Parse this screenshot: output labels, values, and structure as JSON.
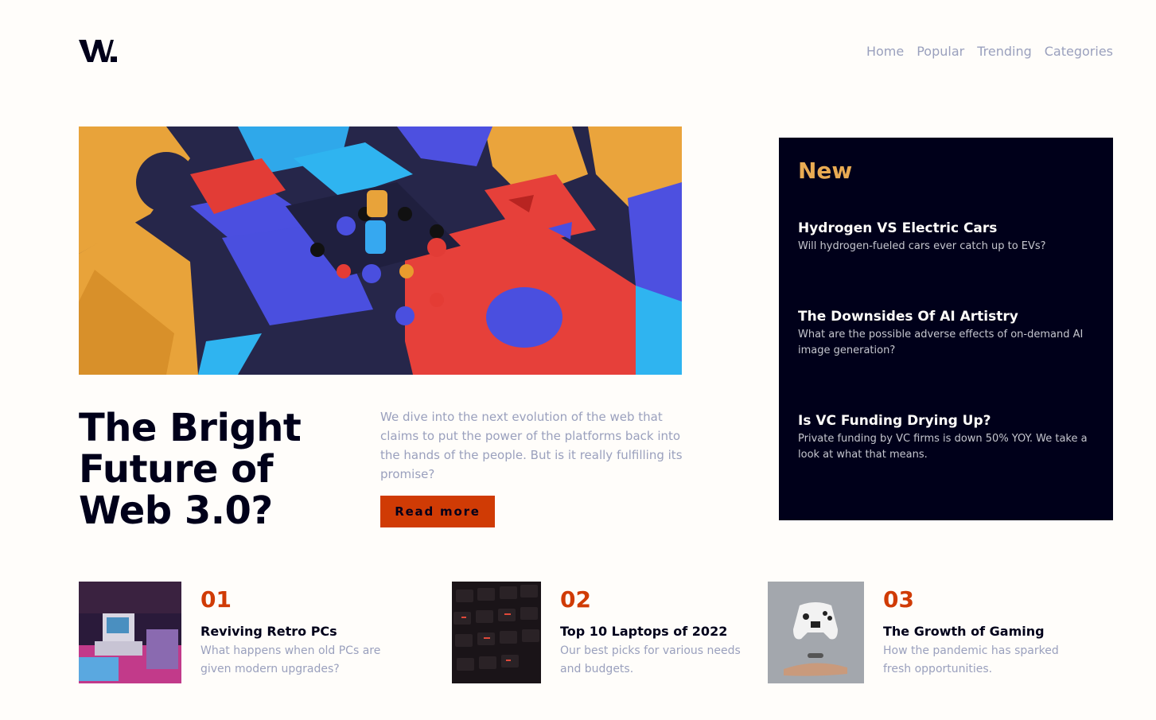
{
  "logo": {
    "text": "W."
  },
  "nav": {
    "items": [
      "Home",
      "Popular",
      "Trending",
      "Categories"
    ]
  },
  "hero": {
    "title": "The Bright Future of Web 3.0?",
    "description": "We dive into the next evolution of the web that claims to put the power of the platforms back into the hands of the people. But is it really fulfilling its promise?",
    "button_label": "Read more"
  },
  "new_panel": {
    "heading": "New",
    "items": [
      {
        "title": "Hydrogen VS Electric Cars",
        "description": "Will hydrogen-fueled cars ever catch up to EVs?"
      },
      {
        "title": "The Downsides Of AI Artistry",
        "description": "What are the possible adverse effects of on-demand AI image generation?"
      },
      {
        "title": "Is VC Funding Drying Up?",
        "description": "Private funding by VC firms is down 50% YOY. We take a look at what that means."
      }
    ]
  },
  "articles": [
    {
      "number": "01",
      "title": "Reviving Retro PCs",
      "description": "What happens when old PCs are given modern upgrades?"
    },
    {
      "number": "02",
      "title": "Top 10 Laptops of 2022",
      "description": "Our best picks for various needs and budgets."
    },
    {
      "number": "03",
      "title": "The Growth of Gaming",
      "description": "How the pandemic has sparked fresh opportunities."
    }
  ],
  "colors": {
    "background": "#fffdfa",
    "dark_navy": "#00001a",
    "soft_red": "#d03b05",
    "soft_orange": "#e9ab53",
    "grayish_blue": "#9aa0bd"
  }
}
